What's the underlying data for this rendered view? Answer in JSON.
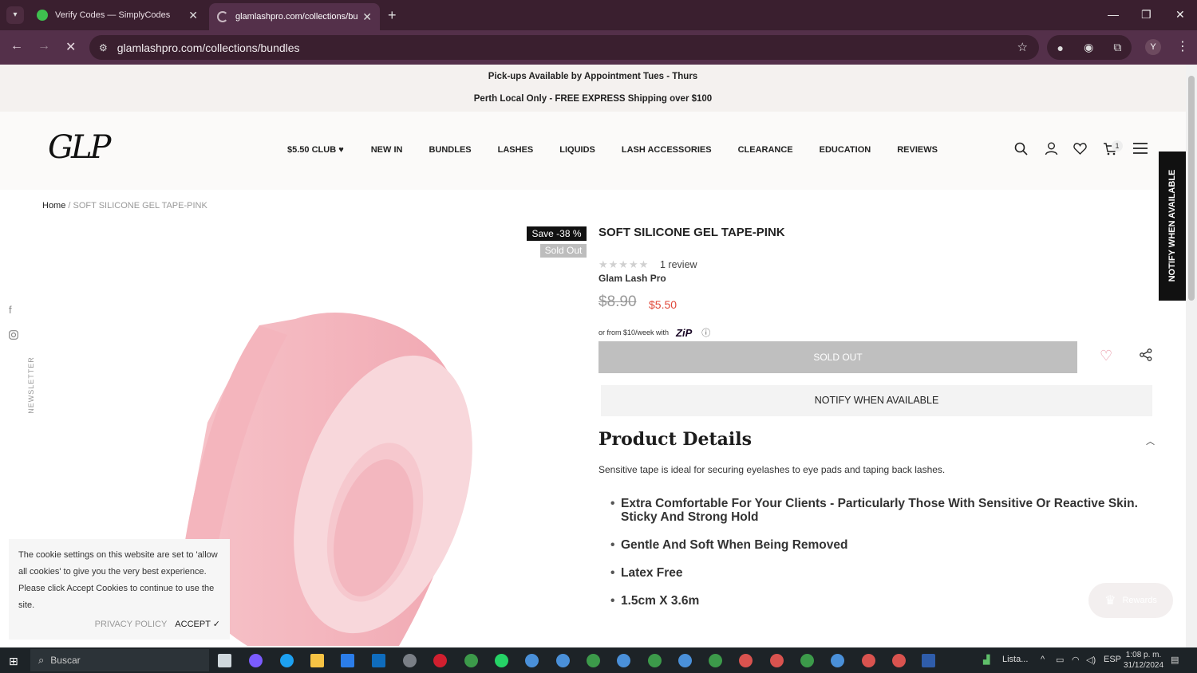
{
  "browser": {
    "tabs": [
      {
        "title": "Verify Codes — SimplyCodes",
        "favicon_color": "#3fbf4f",
        "active": false
      },
      {
        "title": "glamlashpro.com/collections/bundles",
        "favicon_color": "#c9b8c2",
        "active": true
      }
    ],
    "url": "glamlashpro.com/collections/bundles",
    "profile_initial": "Y"
  },
  "announcement": {
    "line1": "Pick-ups Available by Appointment Tues - Thurs",
    "line2": "Perth Local Only - FREE EXPRESS Shipping over $100"
  },
  "header": {
    "logo": "GLP",
    "nav": [
      "$5.50 CLUB ♥",
      "NEW IN",
      "BUNDLES",
      "LASHES",
      "LIQUIDS",
      "LASH ACCESSORIES",
      "CLEARANCE",
      "EDUCATION",
      "REVIEWS"
    ],
    "cart_count": "1"
  },
  "breadcrumb": {
    "home": "Home",
    "separator": " / ",
    "current": "SOFT SILICONE GEL TAPE-PINK"
  },
  "sidebar": {
    "newsletter": "NEWSLETTER"
  },
  "product": {
    "badge_save": "Save -38 %",
    "badge_sold": "Sold Out",
    "title": "SOFT SILICONE GEL TAPE-PINK",
    "rating": 0,
    "review_text": "1 review",
    "vendor": "Glam Lash Pro",
    "price_old": "$8.90",
    "price_new": "$5.50",
    "zip_text": "or from $10/week with",
    "zip_logo": "ZiP",
    "sold_out_button": "SOLD OUT",
    "notify_button": "NOTIFY WHEN AVAILABLE",
    "details_heading": "Product Details",
    "description": "Sensitive tape is ideal for securing eyelashes to eye pads and taping back lashes.",
    "features": [
      "Extra Comfortable For Your Clients - Particularly Those With Sensitive Or Reactive Skin. Sticky And Strong Hold",
      "Gentle And Soft When Being Removed",
      "Latex Free",
      "1.5cm X 3.6m"
    ],
    "image_color": "#f4b5bd"
  },
  "cookie": {
    "text": "The cookie settings on this website are set to 'allow all cookies' to give you the very best experience. Please click Accept Cookies to continue to use the site.",
    "privacy": "PRIVACY POLICY",
    "accept": "ACCEPT ✓"
  },
  "notify_tab": "NOTIFY WHEN AVAILABLE",
  "rewards": "Rewards",
  "taskbar": {
    "search_placeholder": "Buscar",
    "tray_app": "Lista...",
    "lang": "ESP",
    "time": "1:08 p. m.",
    "date": "31/12/2024"
  }
}
